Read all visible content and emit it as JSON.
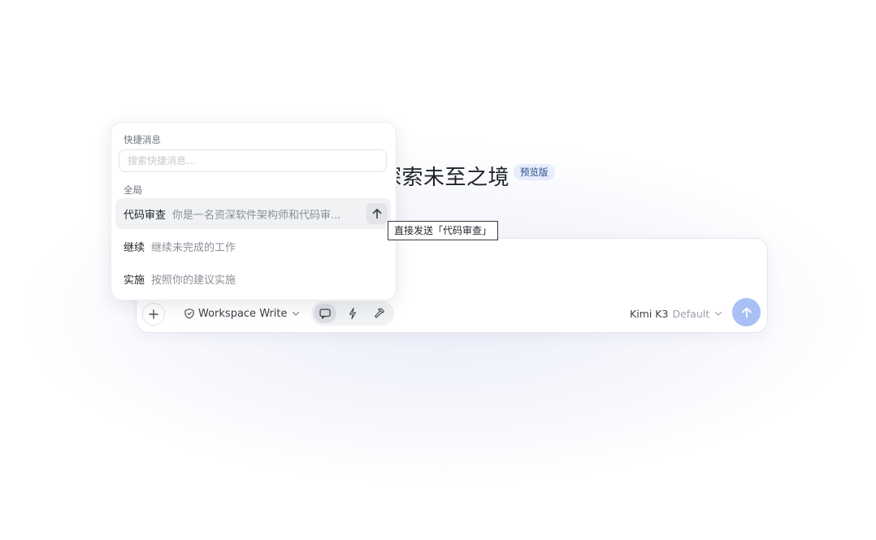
{
  "hero": {
    "title": "探索未至之境",
    "badge": "预览版"
  },
  "composer": {
    "add_icon": "plus-icon",
    "permission": {
      "icon": "shield-icon",
      "label": "Workspace Write"
    },
    "modes": [
      {
        "name": "chat",
        "icon": "chat-bubble-icon",
        "active": true
      },
      {
        "name": "fast",
        "icon": "lightning-icon",
        "active": false
      },
      {
        "name": "build",
        "icon": "hammer-icon",
        "active": false
      }
    ],
    "model": {
      "name": "Kimi K3",
      "variant": "Default"
    },
    "send_icon": "arrow-up-icon",
    "send_color": "#a9c0f5"
  },
  "quick_messages": {
    "title": "快捷消息",
    "search_placeholder": "搜索快捷消息...",
    "group_label": "全局",
    "items": [
      {
        "name": "代码审查",
        "desc": "你是一名资深软件架构师和代码审..."
      },
      {
        "name": "继续",
        "desc": "继续未完成的工作"
      },
      {
        "name": "实施",
        "desc": "按照你的建议实施"
      }
    ],
    "tooltip": "直接发送「代码审查」"
  }
}
